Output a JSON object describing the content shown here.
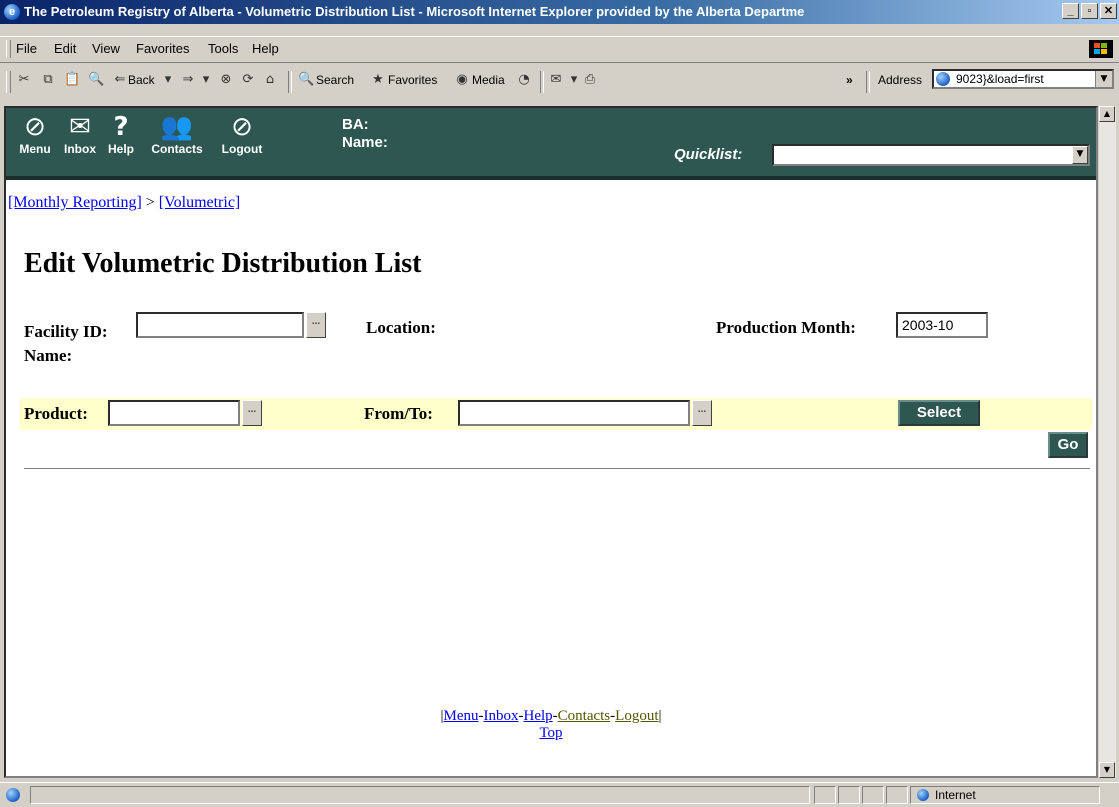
{
  "window": {
    "title": "The Petroleum Registry of Alberta - Volumetric Distribution List - Microsoft Internet Explorer provided by the Alberta Departme",
    "buttons": {
      "minimize": "_",
      "maximize": "▫",
      "close": "✕"
    }
  },
  "menubar": {
    "items": [
      "File",
      "Edit",
      "View",
      "Favorites",
      "Tools",
      "Help"
    ]
  },
  "toolbar": {
    "back": "Back",
    "search": "Search",
    "favorites": "Favorites",
    "media": "Media",
    "chevron": "»",
    "address_label": "Address",
    "address_value": "9023}&load=first"
  },
  "app_nav": {
    "items": [
      {
        "label": "Menu",
        "icon": "menu-icon",
        "glyph": "⊘"
      },
      {
        "label": "Inbox",
        "icon": "inbox-icon",
        "glyph": "✉"
      },
      {
        "label": "Help",
        "icon": "help-icon",
        "glyph": "?"
      },
      {
        "label": "Contacts",
        "icon": "contacts-icon",
        "glyph": "👥"
      },
      {
        "label": "Logout",
        "icon": "logout-icon",
        "glyph": "⊘"
      }
    ],
    "ba_label": "BA:",
    "name_label": "Name:",
    "quicklist_label": "Quicklist:",
    "quicklist_value": ""
  },
  "breadcrumb": {
    "items": [
      "[Monthly Reporting]",
      "[Volumetric]"
    ],
    "separator": ">"
  },
  "page": {
    "title": "Edit Volumetric Distribution List",
    "facility_label": "Facility ID:",
    "facility_value": "",
    "location_label": "Location:",
    "production_month_label": "Production Month:",
    "production_month_value": "2003-10",
    "name_label": "Name:",
    "product_label": "Product:",
    "product_value": "",
    "fromto_label": "From/To:",
    "fromto_value": "",
    "lookup_button": "...",
    "select_button": "Select",
    "go_button": "Go"
  },
  "footer": {
    "links": [
      "Menu",
      "Inbox",
      "Help",
      "Contacts",
      "Logout"
    ],
    "top": "Top"
  },
  "statusbar": {
    "zone": "Internet"
  },
  "colors": {
    "app_header": "#2f5752",
    "highlight_row": "#ffffcc",
    "link": "#0000ee"
  }
}
